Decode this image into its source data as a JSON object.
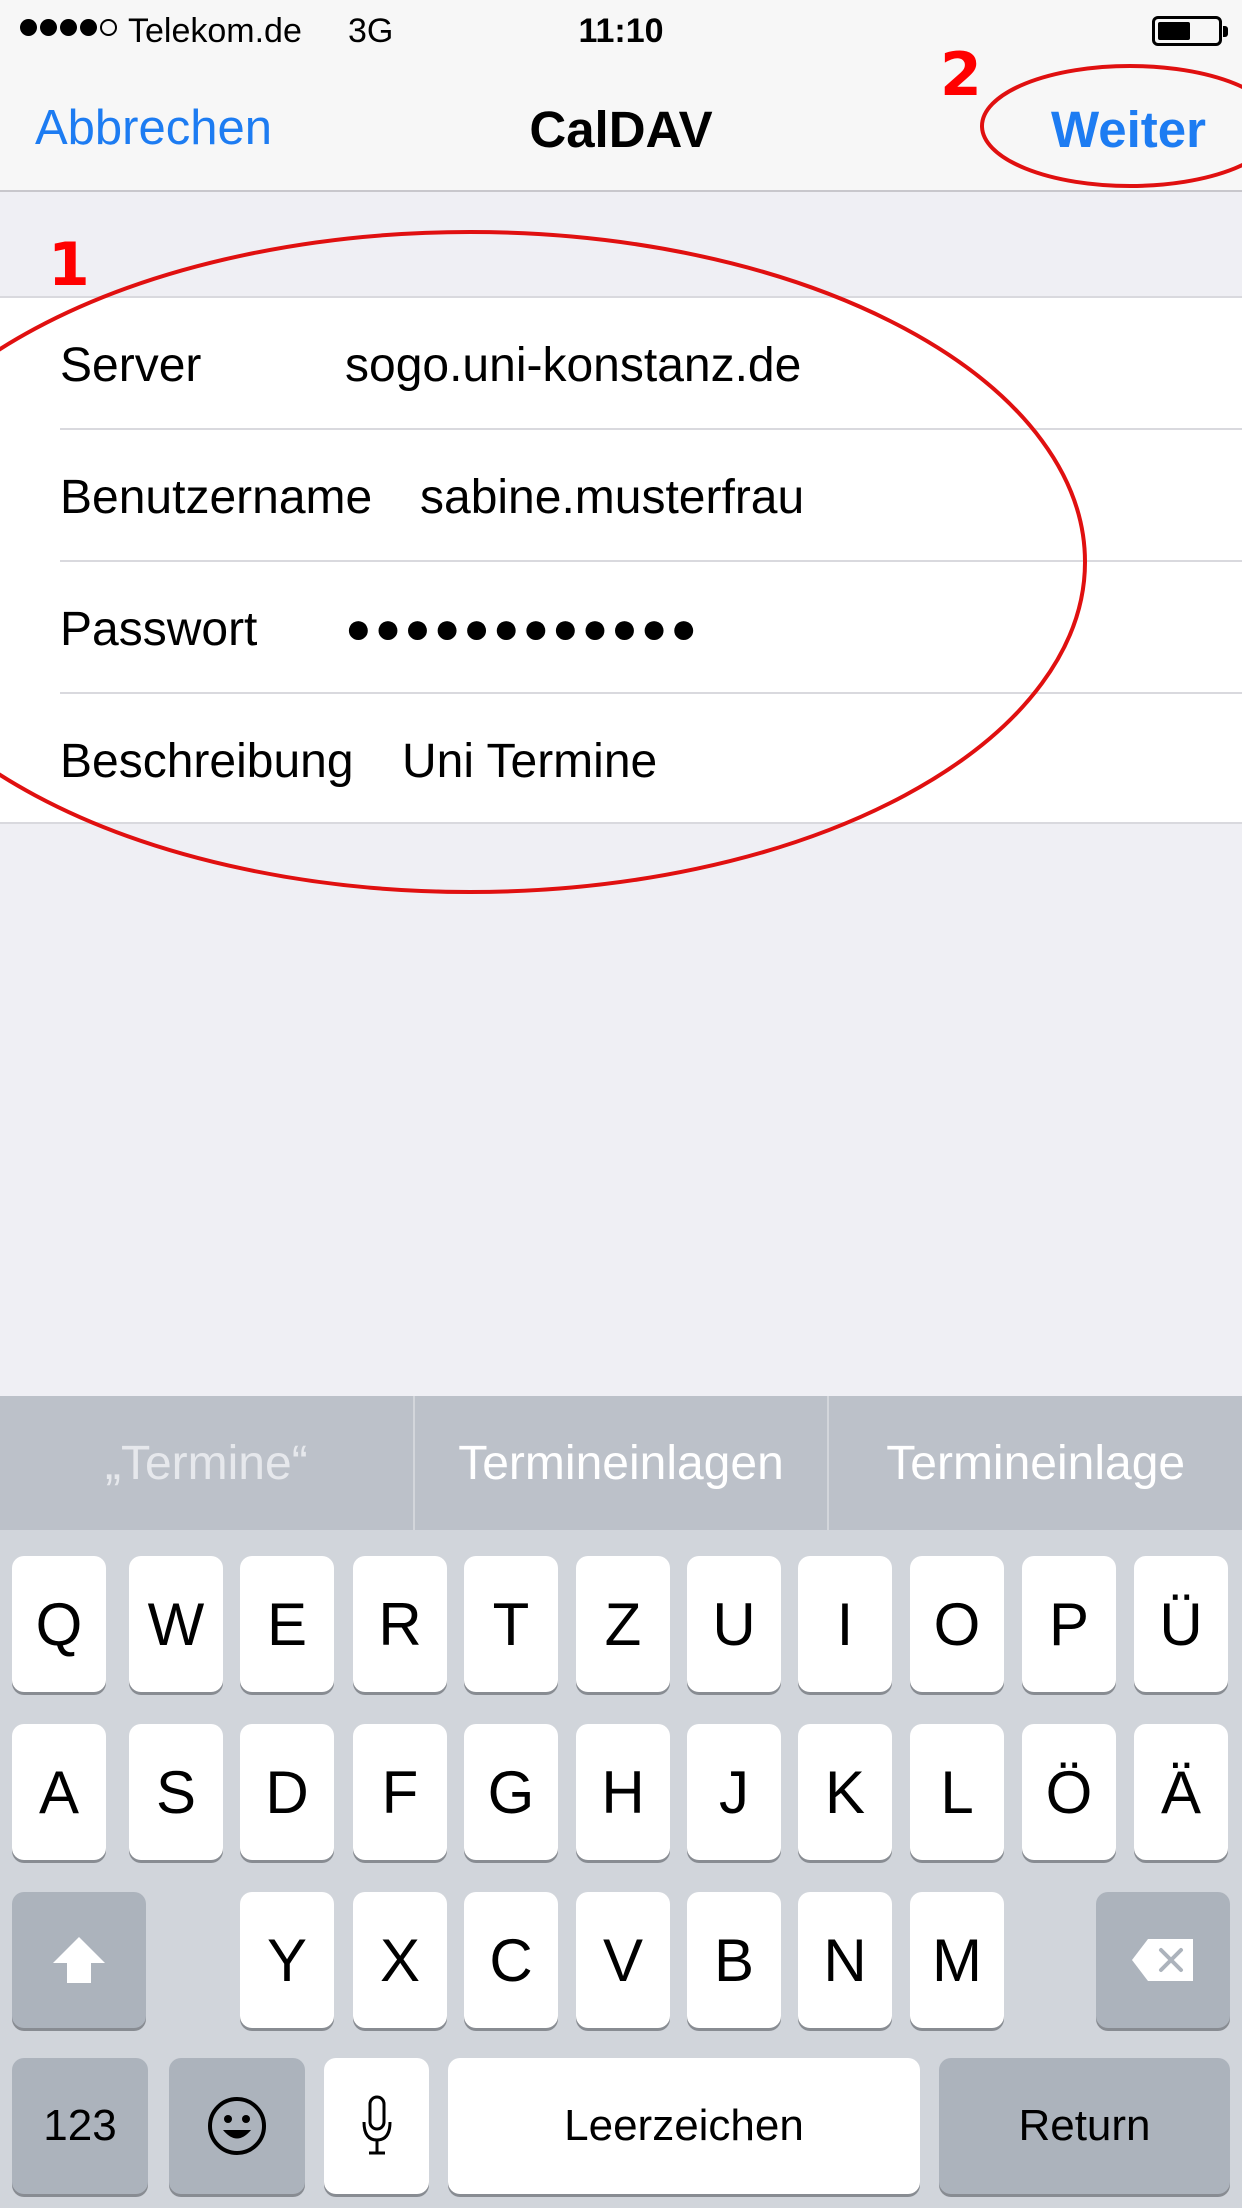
{
  "status_bar": {
    "carrier": "Telekom.de",
    "network": "3G",
    "time": "11:10",
    "signal_bars": 4,
    "battery_level": 0.5
  },
  "nav": {
    "cancel": "Abbrechen",
    "title": "CalDAV",
    "next": "Weiter"
  },
  "form": {
    "rows": [
      {
        "label": "Server",
        "value": "sogo.uni-konstanz.de"
      },
      {
        "label": "Benutzername",
        "value": "sabine.musterfrau"
      },
      {
        "label": "Passwort",
        "value": "●●●●●●●●●●●●"
      },
      {
        "label": "Beschreibung",
        "value": "Uni Termine"
      }
    ]
  },
  "annotations": {
    "marker_1": "1",
    "marker_2": "2",
    "color": "#ff0000"
  },
  "suggestions": [
    "„Termine“",
    "Termineinlagen",
    "Termineinlage"
  ],
  "keyboard": {
    "row1": [
      "Q",
      "W",
      "E",
      "R",
      "T",
      "Z",
      "U",
      "I",
      "O",
      "P",
      "Ü"
    ],
    "row2": [
      "A",
      "S",
      "D",
      "F",
      "G",
      "H",
      "J",
      "K",
      "L",
      "Ö",
      "Ä"
    ],
    "row3": [
      "Y",
      "X",
      "C",
      "V",
      "B",
      "N",
      "M"
    ],
    "numbers_key": "123",
    "space_key": "Leerzeichen",
    "return_key": "Return",
    "icons": [
      "shift-icon",
      "backspace-icon",
      "emoji-icon",
      "microphone-icon"
    ]
  },
  "colors": {
    "accent": "#1d7cf2",
    "annotation": "#ff0000"
  }
}
